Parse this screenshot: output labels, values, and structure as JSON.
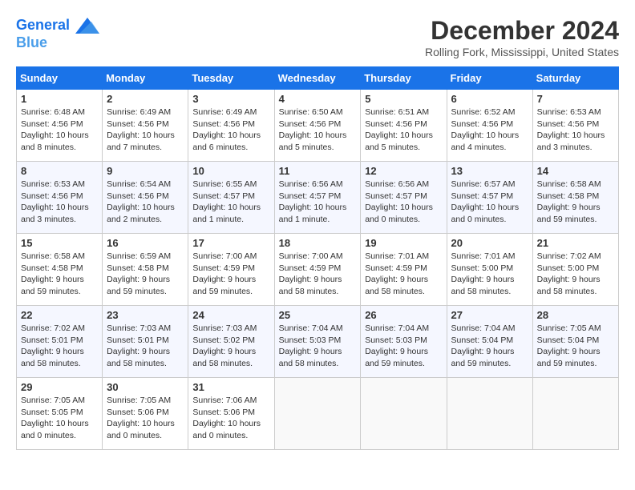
{
  "header": {
    "logo_line1": "General",
    "logo_line2": "Blue",
    "month_title": "December 2024",
    "location": "Rolling Fork, Mississippi, United States"
  },
  "weekdays": [
    "Sunday",
    "Monday",
    "Tuesday",
    "Wednesday",
    "Thursday",
    "Friday",
    "Saturday"
  ],
  "weeks": [
    [
      {
        "day": "1",
        "info": "Sunrise: 6:48 AM\nSunset: 4:56 PM\nDaylight: 10 hours\nand 8 minutes."
      },
      {
        "day": "2",
        "info": "Sunrise: 6:49 AM\nSunset: 4:56 PM\nDaylight: 10 hours\nand 7 minutes."
      },
      {
        "day": "3",
        "info": "Sunrise: 6:49 AM\nSunset: 4:56 PM\nDaylight: 10 hours\nand 6 minutes."
      },
      {
        "day": "4",
        "info": "Sunrise: 6:50 AM\nSunset: 4:56 PM\nDaylight: 10 hours\nand 5 minutes."
      },
      {
        "day": "5",
        "info": "Sunrise: 6:51 AM\nSunset: 4:56 PM\nDaylight: 10 hours\nand 5 minutes."
      },
      {
        "day": "6",
        "info": "Sunrise: 6:52 AM\nSunset: 4:56 PM\nDaylight: 10 hours\nand 4 minutes."
      },
      {
        "day": "7",
        "info": "Sunrise: 6:53 AM\nSunset: 4:56 PM\nDaylight: 10 hours\nand 3 minutes."
      }
    ],
    [
      {
        "day": "8",
        "info": "Sunrise: 6:53 AM\nSunset: 4:56 PM\nDaylight: 10 hours\nand 3 minutes."
      },
      {
        "day": "9",
        "info": "Sunrise: 6:54 AM\nSunset: 4:56 PM\nDaylight: 10 hours\nand 2 minutes."
      },
      {
        "day": "10",
        "info": "Sunrise: 6:55 AM\nSunset: 4:57 PM\nDaylight: 10 hours\nand 1 minute."
      },
      {
        "day": "11",
        "info": "Sunrise: 6:56 AM\nSunset: 4:57 PM\nDaylight: 10 hours\nand 1 minute."
      },
      {
        "day": "12",
        "info": "Sunrise: 6:56 AM\nSunset: 4:57 PM\nDaylight: 10 hours\nand 0 minutes."
      },
      {
        "day": "13",
        "info": "Sunrise: 6:57 AM\nSunset: 4:57 PM\nDaylight: 10 hours\nand 0 minutes."
      },
      {
        "day": "14",
        "info": "Sunrise: 6:58 AM\nSunset: 4:58 PM\nDaylight: 9 hours\nand 59 minutes."
      }
    ],
    [
      {
        "day": "15",
        "info": "Sunrise: 6:58 AM\nSunset: 4:58 PM\nDaylight: 9 hours\nand 59 minutes."
      },
      {
        "day": "16",
        "info": "Sunrise: 6:59 AM\nSunset: 4:58 PM\nDaylight: 9 hours\nand 59 minutes."
      },
      {
        "day": "17",
        "info": "Sunrise: 7:00 AM\nSunset: 4:59 PM\nDaylight: 9 hours\nand 59 minutes."
      },
      {
        "day": "18",
        "info": "Sunrise: 7:00 AM\nSunset: 4:59 PM\nDaylight: 9 hours\nand 58 minutes."
      },
      {
        "day": "19",
        "info": "Sunrise: 7:01 AM\nSunset: 4:59 PM\nDaylight: 9 hours\nand 58 minutes."
      },
      {
        "day": "20",
        "info": "Sunrise: 7:01 AM\nSunset: 5:00 PM\nDaylight: 9 hours\nand 58 minutes."
      },
      {
        "day": "21",
        "info": "Sunrise: 7:02 AM\nSunset: 5:00 PM\nDaylight: 9 hours\nand 58 minutes."
      }
    ],
    [
      {
        "day": "22",
        "info": "Sunrise: 7:02 AM\nSunset: 5:01 PM\nDaylight: 9 hours\nand 58 minutes."
      },
      {
        "day": "23",
        "info": "Sunrise: 7:03 AM\nSunset: 5:01 PM\nDaylight: 9 hours\nand 58 minutes."
      },
      {
        "day": "24",
        "info": "Sunrise: 7:03 AM\nSunset: 5:02 PM\nDaylight: 9 hours\nand 58 minutes."
      },
      {
        "day": "25",
        "info": "Sunrise: 7:04 AM\nSunset: 5:03 PM\nDaylight: 9 hours\nand 58 minutes."
      },
      {
        "day": "26",
        "info": "Sunrise: 7:04 AM\nSunset: 5:03 PM\nDaylight: 9 hours\nand 59 minutes."
      },
      {
        "day": "27",
        "info": "Sunrise: 7:04 AM\nSunset: 5:04 PM\nDaylight: 9 hours\nand 59 minutes."
      },
      {
        "day": "28",
        "info": "Sunrise: 7:05 AM\nSunset: 5:04 PM\nDaylight: 9 hours\nand 59 minutes."
      }
    ],
    [
      {
        "day": "29",
        "info": "Sunrise: 7:05 AM\nSunset: 5:05 PM\nDaylight: 10 hours\nand 0 minutes."
      },
      {
        "day": "30",
        "info": "Sunrise: 7:05 AM\nSunset: 5:06 PM\nDaylight: 10 hours\nand 0 minutes."
      },
      {
        "day": "31",
        "info": "Sunrise: 7:06 AM\nSunset: 5:06 PM\nDaylight: 10 hours\nand 0 minutes."
      },
      {
        "day": "",
        "info": ""
      },
      {
        "day": "",
        "info": ""
      },
      {
        "day": "",
        "info": ""
      },
      {
        "day": "",
        "info": ""
      }
    ]
  ]
}
